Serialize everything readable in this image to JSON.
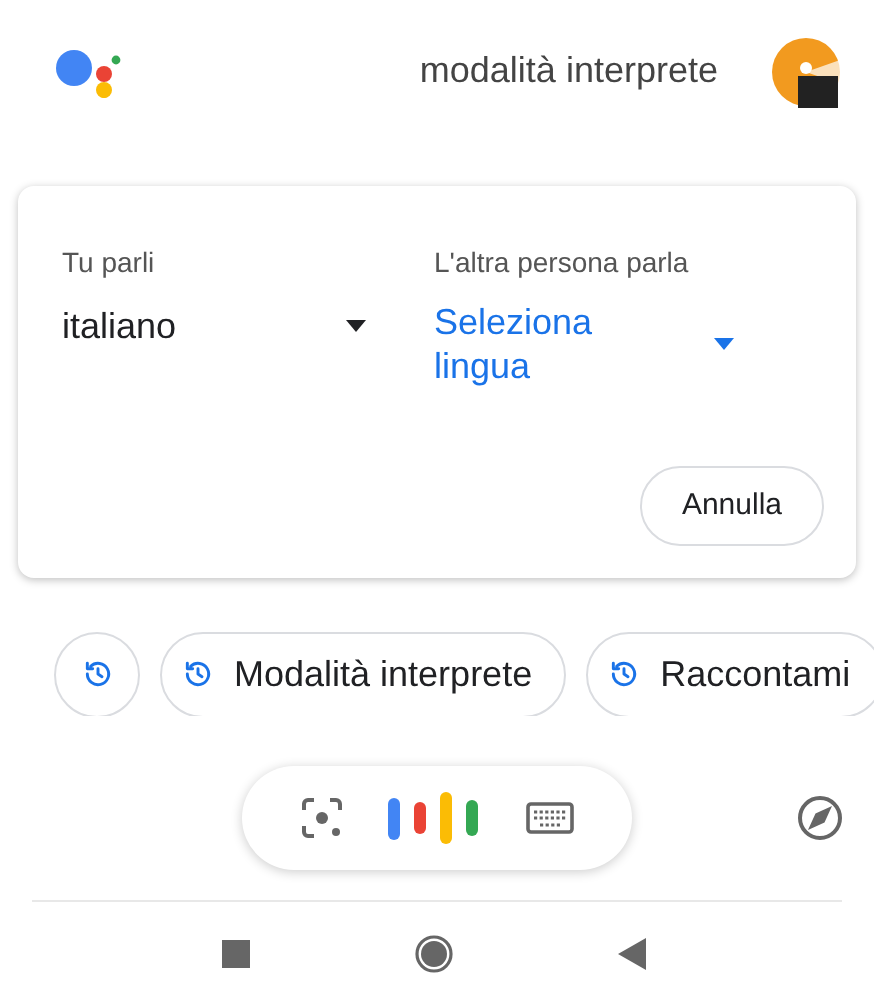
{
  "header": {
    "title": "modalità interprete"
  },
  "card": {
    "source": {
      "label": "Tu parli",
      "value": "italiano"
    },
    "target": {
      "label": "L'altra persona parla",
      "value": "Seleziona lingua"
    },
    "cancel_button": "Annulla"
  },
  "suggestions": [
    {
      "kind": "history"
    },
    {
      "kind": "chip",
      "label": "Modalità interprete"
    },
    {
      "kind": "chip",
      "label": "Raccontami"
    }
  ]
}
